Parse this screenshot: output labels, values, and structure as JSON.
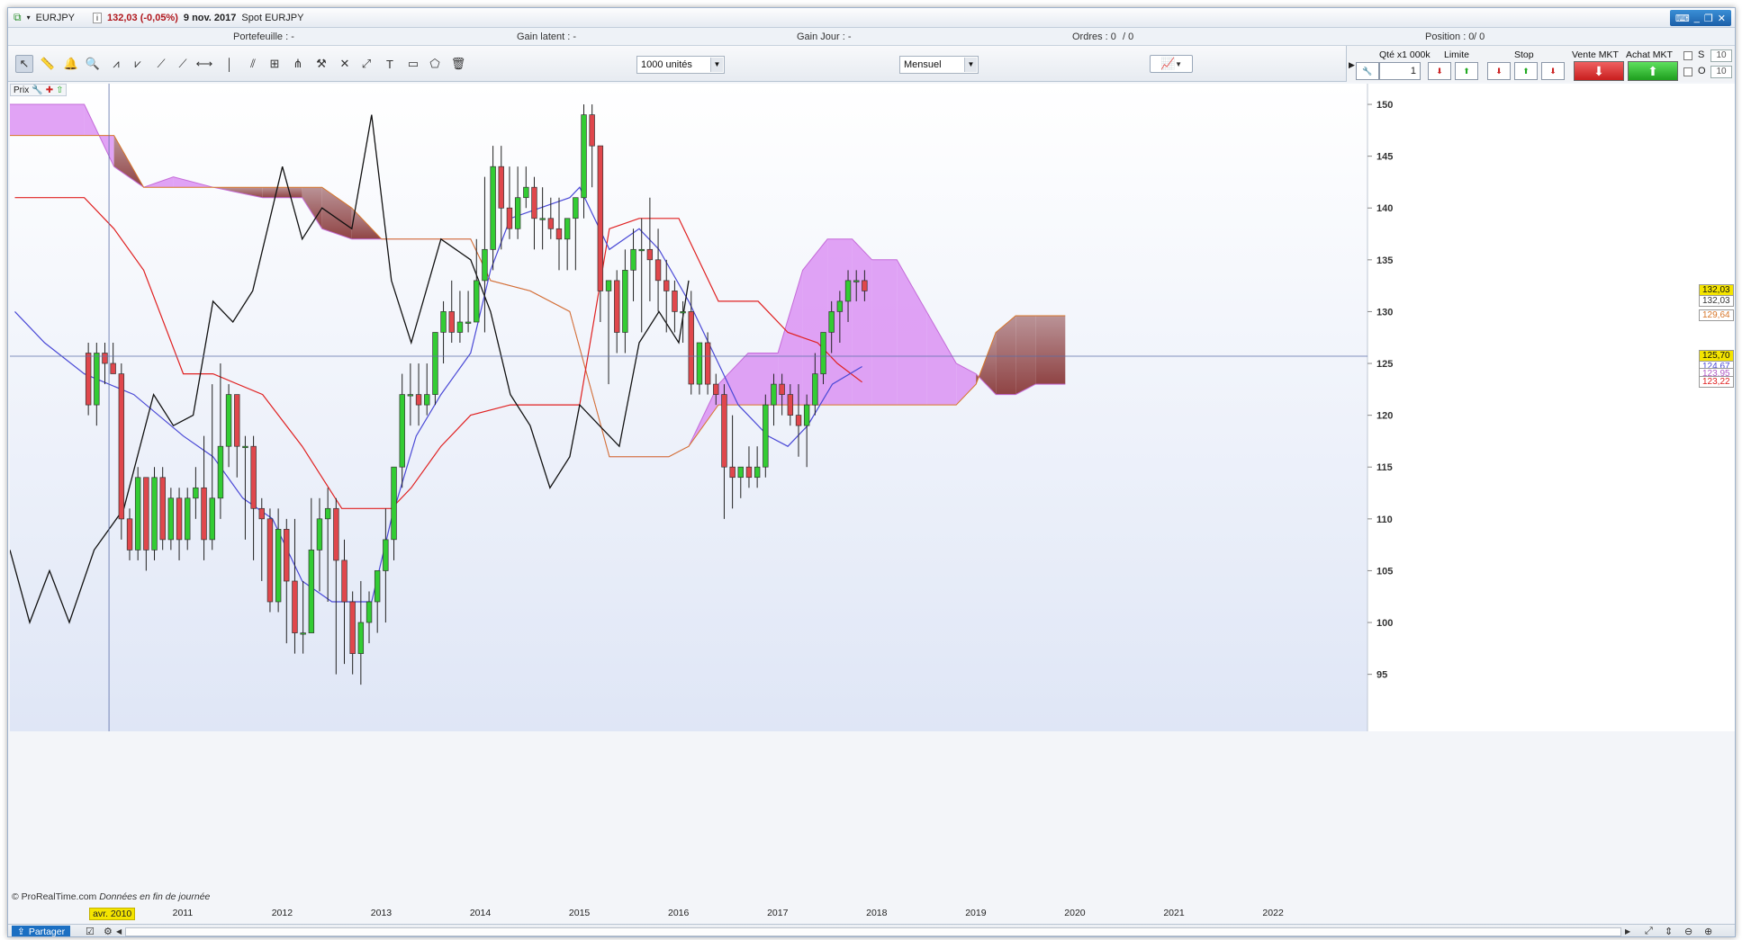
{
  "window": {
    "symbol": "EURJPY",
    "price_change": "132,03 (-0,05%)",
    "date": "9 nov. 2017",
    "instrument": "Spot EURJPY"
  },
  "infobar": {
    "portefeuille": "Portefeuille : -",
    "gain_latent": "Gain latent : -",
    "gain_jour": "Gain Jour : -",
    "ordres": "Ordres : 0",
    "ordres_sep": "/ 0",
    "position": "Position : 0",
    "position_sep": "/ 0"
  },
  "toolbar": {
    "units_select": "1000 unités",
    "period_select": "Mensuel"
  },
  "order_panel": {
    "qty_label": "Qté x1 000k",
    "qty_value": "1",
    "limite_label": "Limite",
    "stop_label": "Stop",
    "vente_label": "Vente MKT",
    "achat_label": "Achat MKT",
    "s_label": "S",
    "o_label": "O",
    "s_value": "10",
    "o_value": "10"
  },
  "chart_tag": "Prix",
  "copyright": "© ProRealTime.com",
  "copyright_note": "Données en fin de journée",
  "colors": {
    "up": "#33cc33",
    "down": "#e0474c",
    "tenkan": "#4a49d6",
    "kijun": "#e02020",
    "chikou": "#111111",
    "cloud_bull": "#d98cf2",
    "cloud_bear": "#8a3a3a"
  },
  "bottom": {
    "share_label": "Partager"
  },
  "chart_data": {
    "type": "candlestick",
    "period": "monthly",
    "title": "",
    "y_ticks": [
      95,
      100,
      105,
      110,
      115,
      120,
      125,
      130,
      135,
      140,
      145,
      150
    ],
    "ylim": [
      89.5,
      152
    ],
    "x_tick_labels": [
      "avr. 2010",
      "2011",
      "2012",
      "2013",
      "2014",
      "2015",
      "2016",
      "2017",
      "2018",
      "2019",
      "2020",
      "2021",
      "2022"
    ],
    "x_ticks": [
      2010.25,
      2011,
      2012,
      2013,
      2014,
      2015,
      2016,
      2017,
      2018,
      2019,
      2020,
      2021,
      2022
    ],
    "xlim": [
      2009.25,
      2022.95
    ],
    "price_tags": [
      {
        "label": "132,03",
        "value": 132.03,
        "style": "last"
      },
      {
        "label": "132,03",
        "value": 131.0,
        "style": "plain"
      },
      {
        "label": "129,64",
        "value": 129.64,
        "style": "cloud"
      },
      {
        "label": "125,70",
        "value": 125.7,
        "style": "cursor"
      },
      {
        "label": "124,67",
        "value": 124.67,
        "style": "tenkan"
      },
      {
        "label": "123,95",
        "value": 123.95,
        "style": "cloud2"
      },
      {
        "label": "123,22",
        "value": 123.22,
        "style": "kijun"
      }
    ],
    "cursor": {
      "x": 2010.25,
      "y": 125.7
    },
    "candles": [
      [
        "2010-01",
        126,
        127,
        120,
        121
      ],
      [
        "2010-02",
        121,
        127,
        119,
        126
      ],
      [
        "2010-03",
        126,
        127,
        123,
        125
      ],
      [
        "2010-04",
        125,
        127,
        124,
        124
      ],
      [
        "2010-05",
        124,
        125,
        108,
        110
      ],
      [
        "2010-06",
        110,
        111,
        106,
        107
      ],
      [
        "2010-07",
        107,
        115,
        106,
        114
      ],
      [
        "2010-08",
        114,
        114,
        105,
        107
      ],
      [
        "2010-09",
        107,
        115,
        106,
        114
      ],
      [
        "2010-10",
        114,
        115,
        107,
        108
      ],
      [
        "2010-11",
        108,
        113,
        107,
        112
      ],
      [
        "2010-12",
        112,
        113,
        106,
        108
      ],
      [
        "2011-01",
        108,
        113,
        107,
        112
      ],
      [
        "2011-02",
        112,
        115,
        110,
        113
      ],
      [
        "2011-03",
        113,
        118,
        106,
        108
      ],
      [
        "2011-04",
        108,
        123,
        107,
        112
      ],
      [
        "2011-05",
        112,
        125,
        110,
        117
      ],
      [
        "2011-06",
        117,
        123,
        115,
        122
      ],
      [
        "2011-07",
        122,
        122,
        114,
        117
      ],
      [
        "2011-08",
        117,
        118,
        108,
        117
      ],
      [
        "2011-09",
        117,
        118,
        106,
        111
      ],
      [
        "2011-10",
        111,
        112,
        104,
        110
      ],
      [
        "2011-11",
        110,
        111,
        101,
        102
      ],
      [
        "2011-12",
        102,
        111,
        101,
        109
      ],
      [
        "2012-01",
        109,
        110,
        98,
        104
      ],
      [
        "2012-02",
        104,
        110,
        97,
        99
      ],
      [
        "2012-03",
        99,
        104,
        97,
        99
      ],
      [
        "2012-04",
        99,
        112,
        99,
        107
      ],
      [
        "2012-05",
        107,
        112,
        103,
        110
      ],
      [
        "2012-06",
        110,
        113,
        102,
        111
      ],
      [
        "2012-07",
        111,
        112,
        95,
        106
      ],
      [
        "2012-08",
        106,
        108,
        96,
        102
      ],
      [
        "2012-09",
        102,
        103,
        95,
        97
      ],
      [
        "2012-10",
        97,
        104,
        94,
        100
      ],
      [
        "2012-11",
        100,
        103,
        98,
        102
      ],
      [
        "2012-12",
        102,
        105,
        99,
        105
      ],
      [
        "2013-01",
        105,
        111,
        100,
        108
      ],
      [
        "2013-02",
        108,
        115,
        106,
        115
      ],
      [
        "2013-03",
        115,
        124,
        113,
        122
      ],
      [
        "2013-04",
        122,
        125,
        119,
        122
      ],
      [
        "2013-05",
        122,
        125,
        119,
        121
      ],
      [
        "2013-06",
        121,
        125,
        120,
        122
      ],
      [
        "2013-07",
        122,
        128,
        121,
        128
      ],
      [
        "2013-08",
        128,
        131,
        125,
        130
      ],
      [
        "2013-09",
        130,
        133,
        127,
        128
      ],
      [
        "2013-10",
        128,
        132,
        127,
        129
      ],
      [
        "2013-11",
        129,
        132,
        128,
        129
      ],
      [
        "2013-12",
        129,
        137,
        129,
        133
      ],
      [
        "2014-01",
        133,
        143,
        128,
        136
      ],
      [
        "2014-02",
        136,
        146,
        134,
        144
      ],
      [
        "2014-03",
        144,
        146,
        136,
        140
      ],
      [
        "2014-04",
        140,
        144,
        137,
        138
      ],
      [
        "2014-05",
        138,
        144,
        137,
        141
      ],
      [
        "2014-06",
        141,
        144,
        140,
        142
      ],
      [
        "2014-07",
        142,
        143,
        136,
        139
      ],
      [
        "2014-08",
        139,
        142,
        136,
        139
      ],
      [
        "2014-09",
        139,
        141,
        137,
        138
      ],
      [
        "2014-10",
        138,
        141,
        134,
        137
      ],
      [
        "2014-11",
        137,
        139,
        134,
        139
      ],
      [
        "2014-12",
        139,
        141,
        134,
        141
      ],
      [
        "2015-01",
        141,
        150,
        139,
        149
      ],
      [
        "2015-02",
        149,
        150,
        142,
        146
      ],
      [
        "2015-03",
        146,
        146,
        129,
        132
      ],
      [
        "2015-04",
        132,
        133,
        123,
        133
      ],
      [
        "2015-05",
        133,
        134,
        126,
        128
      ],
      [
        "2015-06",
        128,
        136,
        126,
        134
      ],
      [
        "2015-07",
        134,
        138,
        131,
        136
      ],
      [
        "2015-08",
        136,
        139,
        128,
        136
      ],
      [
        "2015-09",
        136,
        141,
        131,
        135
      ],
      [
        "2015-10",
        135,
        138,
        130,
        133
      ],
      [
        "2015-11",
        133,
        135,
        128,
        132
      ],
      [
        "2015-12",
        132,
        133,
        128,
        130
      ],
      [
        "2016-01",
        130,
        131,
        127,
        130
      ],
      [
        "2016-02",
        130,
        132,
        122,
        123
      ],
      [
        "2016-03",
        123,
        127,
        122,
        127
      ],
      [
        "2016-04",
        127,
        128,
        122,
        123
      ],
      [
        "2016-05",
        123,
        124,
        121,
        122
      ],
      [
        "2016-06",
        122,
        123,
        110,
        115
      ],
      [
        "2016-07",
        115,
        120,
        111,
        114
      ],
      [
        "2016-08",
        114,
        115,
        112,
        115
      ],
      [
        "2016-09",
        115,
        117,
        113,
        114
      ],
      [
        "2016-10",
        114,
        117,
        113,
        115
      ],
      [
        "2016-11",
        115,
        122,
        114,
        121
      ],
      [
        "2016-12",
        121,
        124,
        119,
        123
      ],
      [
        "2017-01",
        123,
        124,
        120,
        122
      ],
      [
        "2017-02",
        122,
        123,
        119,
        120
      ],
      [
        "2017-03",
        120,
        123,
        116,
        119
      ],
      [
        "2017-04",
        119,
        122,
        115,
        121
      ],
      [
        "2017-05",
        121,
        126,
        120,
        124
      ],
      [
        "2017-06",
        124,
        128,
        123,
        128
      ],
      [
        "2017-07",
        128,
        131,
        126,
        130
      ],
      [
        "2017-08",
        130,
        132,
        127,
        131
      ],
      [
        "2017-09",
        131,
        134,
        129,
        133
      ],
      [
        "2017-10",
        133,
        134,
        131,
        133
      ],
      [
        "2017-11",
        133,
        134,
        131,
        132
      ]
    ],
    "tenkan": [
      [
        2009.3,
        130
      ],
      [
        2009.6,
        127
      ],
      [
        2010.0,
        124
      ],
      [
        2010.5,
        122
      ],
      [
        2011.0,
        118
      ],
      [
        2011.3,
        116
      ],
      [
        2011.6,
        112
      ],
      [
        2011.9,
        110
      ],
      [
        2012.2,
        104
      ],
      [
        2012.5,
        102
      ],
      [
        2012.9,
        102
      ],
      [
        2013.1,
        110
      ],
      [
        2013.35,
        118
      ],
      [
        2013.6,
        122
      ],
      [
        2013.9,
        126
      ],
      [
        2014.1,
        134
      ],
      [
        2014.3,
        139
      ],
      [
        2014.6,
        140
      ],
      [
        2014.9,
        141
      ],
      [
        2015.0,
        142
      ],
      [
        2015.3,
        136
      ],
      [
        2015.6,
        138
      ],
      [
        2015.8,
        136
      ],
      [
        2016.1,
        131
      ],
      [
        2016.35,
        126
      ],
      [
        2016.6,
        121
      ],
      [
        2016.9,
        118
      ],
      [
        2017.1,
        117
      ],
      [
        2017.3,
        119
      ],
      [
        2017.55,
        123
      ],
      [
        2017.85,
        124.7
      ]
    ],
    "kijun": [
      [
        2009.3,
        141
      ],
      [
        2010.0,
        141
      ],
      [
        2010.3,
        138
      ],
      [
        2010.6,
        134
      ],
      [
        2011.0,
        124
      ],
      [
        2011.3,
        124
      ],
      [
        2011.8,
        122
      ],
      [
        2012.2,
        117
      ],
      [
        2012.6,
        111
      ],
      [
        2012.9,
        111
      ],
      [
        2013.1,
        111
      ],
      [
        2013.3,
        113
      ],
      [
        2013.6,
        117
      ],
      [
        2013.9,
        120
      ],
      [
        2014.3,
        121
      ],
      [
        2015.0,
        121
      ],
      [
        2015.3,
        138
      ],
      [
        2015.6,
        139
      ],
      [
        2016.0,
        139
      ],
      [
        2016.4,
        131
      ],
      [
        2016.8,
        131
      ],
      [
        2017.1,
        128
      ],
      [
        2017.4,
        127
      ],
      [
        2017.6,
        125
      ],
      [
        2017.85,
        123.2
      ]
    ],
    "chikou": [
      [
        2009.25,
        107
      ],
      [
        2009.45,
        100
      ],
      [
        2009.65,
        105
      ],
      [
        2009.85,
        100
      ],
      [
        2010.1,
        107
      ],
      [
        2010.4,
        111
      ],
      [
        2010.7,
        122
      ],
      [
        2010.9,
        119
      ],
      [
        2011.1,
        120
      ],
      [
        2011.3,
        131
      ],
      [
        2011.5,
        129
      ],
      [
        2011.7,
        132
      ],
      [
        2012.0,
        144
      ],
      [
        2012.2,
        137
      ],
      [
        2012.4,
        140
      ],
      [
        2012.7,
        138
      ],
      [
        2012.9,
        149
      ],
      [
        2013.1,
        133
      ],
      [
        2013.3,
        127
      ],
      [
        2013.6,
        137
      ],
      [
        2013.9,
        135
      ],
      [
        2014.1,
        130
      ],
      [
        2014.3,
        122
      ],
      [
        2014.5,
        119
      ],
      [
        2014.7,
        113
      ],
      [
        2014.9,
        116
      ],
      [
        2015.0,
        121
      ],
      [
        2015.2,
        119
      ],
      [
        2015.4,
        117
      ],
      [
        2015.6,
        127
      ],
      [
        2015.8,
        130
      ],
      [
        2016.0,
        127
      ],
      [
        2016.1,
        133
      ]
    ],
    "cloud_a": [
      [
        2009.25,
        150
      ],
      [
        2009.7,
        150
      ],
      [
        2010.0,
        150
      ],
      [
        2010.3,
        144
      ],
      [
        2010.6,
        142
      ],
      [
        2010.9,
        143
      ],
      [
        2011.3,
        142
      ],
      [
        2011.8,
        141
      ],
      [
        2012.2,
        141
      ],
      [
        2012.4,
        138
      ],
      [
        2012.7,
        137
      ],
      [
        2013.0,
        137
      ],
      [
        2013.3,
        137
      ],
      [
        2013.6,
        137
      ],
      [
        2013.9,
        137
      ],
      [
        2014.1,
        133
      ],
      [
        2014.5,
        132
      ],
      [
        2014.9,
        130
      ],
      [
        2015.3,
        116
      ],
      [
        2015.6,
        116
      ],
      [
        2015.9,
        116
      ],
      [
        2016.1,
        117
      ],
      [
        2016.4,
        123
      ],
      [
        2016.7,
        126
      ],
      [
        2017.0,
        126
      ],
      [
        2017.25,
        134
      ],
      [
        2017.5,
        137
      ],
      [
        2017.75,
        137
      ],
      [
        2017.95,
        135
      ],
      [
        2018.2,
        135
      ],
      [
        2018.5,
        130
      ],
      [
        2018.8,
        125
      ],
      [
        2019.0,
        124
      ],
      [
        2019.2,
        122
      ],
      [
        2019.4,
        122
      ],
      [
        2019.6,
        123
      ],
      [
        2019.9,
        123
      ]
    ],
    "cloud_b": [
      [
        2009.25,
        147
      ],
      [
        2009.7,
        147
      ],
      [
        2010.0,
        147
      ],
      [
        2010.3,
        147
      ],
      [
        2010.6,
        142
      ],
      [
        2010.9,
        142
      ],
      [
        2011.3,
        142
      ],
      [
        2011.8,
        142
      ],
      [
        2012.2,
        142
      ],
      [
        2012.4,
        142
      ],
      [
        2012.7,
        140
      ],
      [
        2013.0,
        137
      ],
      [
        2013.3,
        137
      ],
      [
        2013.6,
        137
      ],
      [
        2013.9,
        137
      ],
      [
        2014.1,
        133
      ],
      [
        2014.5,
        132
      ],
      [
        2014.9,
        130
      ],
      [
        2015.3,
        116
      ],
      [
        2015.6,
        116
      ],
      [
        2015.9,
        116
      ],
      [
        2016.1,
        117
      ],
      [
        2016.4,
        121
      ],
      [
        2016.7,
        121
      ],
      [
        2017.0,
        121
      ],
      [
        2017.25,
        121
      ],
      [
        2017.5,
        121
      ],
      [
        2017.75,
        121
      ],
      [
        2017.95,
        121
      ],
      [
        2018.2,
        121
      ],
      [
        2018.5,
        121
      ],
      [
        2018.8,
        121
      ],
      [
        2019.0,
        123
      ],
      [
        2019.2,
        128
      ],
      [
        2019.4,
        129.6
      ],
      [
        2019.6,
        129.6
      ],
      [
        2019.9,
        129.6
      ]
    ]
  }
}
